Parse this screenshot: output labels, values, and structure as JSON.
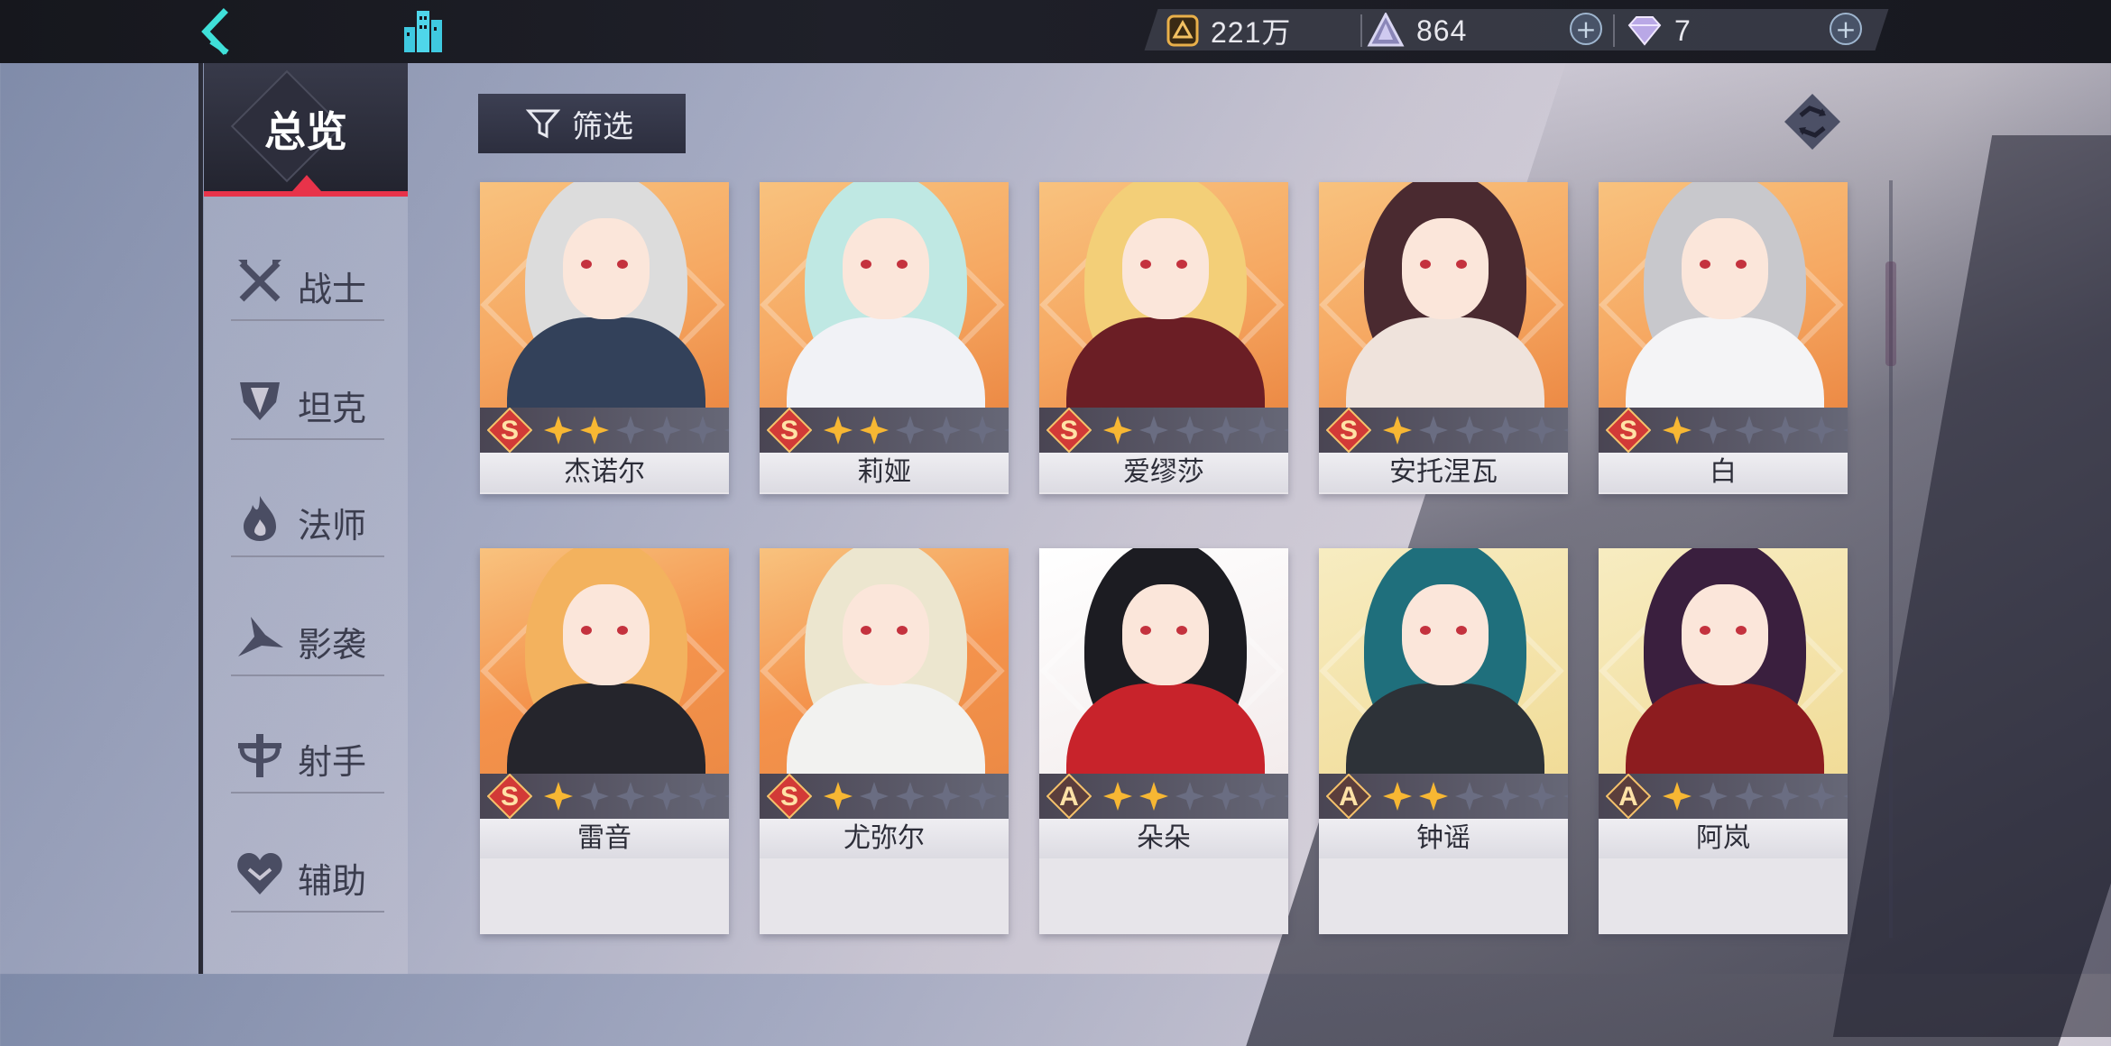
{
  "topbar": {
    "back_icon": "back-arrow-icon",
    "city_icon": "city-icon",
    "resources": [
      {
        "icon": "gold-coin-icon",
        "value": "221万"
      },
      {
        "icon": "crystal-icon",
        "value": "864"
      },
      {
        "icon": "diamond-icon",
        "value": "7"
      }
    ]
  },
  "sidebar": {
    "overview_label": "总览",
    "items": [
      {
        "label": "战士",
        "icon": "sword-icon"
      },
      {
        "label": "坦克",
        "icon": "shield-icon"
      },
      {
        "label": "法师",
        "icon": "flame-icon"
      },
      {
        "label": "影袭",
        "icon": "shadow-icon"
      },
      {
        "label": "射手",
        "icon": "crossbow-icon"
      },
      {
        "label": "辅助",
        "icon": "heart-icon"
      }
    ]
  },
  "filter": {
    "label": "筛选",
    "icon": "filter-icon"
  },
  "refresh_icon": "refresh-icon",
  "characters": [
    {
      "name": "杰诺尔",
      "rank": "S",
      "stars": 2,
      "max_stars": 6,
      "hair": "#dcdcdc",
      "outfit": "#33415a",
      "bg": "#f6a862"
    },
    {
      "name": "莉娅",
      "rank": "S",
      "stars": 2,
      "max_stars": 6,
      "hair": "#bfe8e3",
      "outfit": "#f1f2f6",
      "bg": "#f6a862"
    },
    {
      "name": "爱缪莎",
      "rank": "S",
      "stars": 1,
      "max_stars": 6,
      "hair": "#f3cf78",
      "outfit": "#6b1e25",
      "bg": "#f6a862"
    },
    {
      "name": "安托涅瓦",
      "rank": "S",
      "stars": 1,
      "max_stars": 6,
      "hair": "#4a2a30",
      "outfit": "#efe3dc",
      "bg": "#f6a862"
    },
    {
      "name": "白",
      "rank": "S",
      "stars": 1,
      "max_stars": 6,
      "hair": "#c8c8cc",
      "outfit": "#f4f4f6",
      "bg": "#f6a862"
    },
    {
      "name": "雷音",
      "rank": "S",
      "stars": 1,
      "max_stars": 6,
      "hair": "#f3b25e",
      "outfit": "#25252c",
      "bg": "#f4934c"
    },
    {
      "name": "尤弥尔",
      "rank": "S",
      "stars": 1,
      "max_stars": 6,
      "hair": "#ece6cf",
      "outfit": "#f2f2f0",
      "bg": "#f4934c"
    },
    {
      "name": "朵朵",
      "rank": "A",
      "stars": 2,
      "max_stars": 6,
      "hair": "#1c1c22",
      "outfit": "#c8232b",
      "bg": "#fbfbfb"
    },
    {
      "name": "钟谣",
      "rank": "A",
      "stars": 2,
      "max_stars": 6,
      "hair": "#1f6f7c",
      "outfit": "#2d3238",
      "bg": "#f4e3a8"
    },
    {
      "name": "阿岚",
      "rank": "A",
      "stars": 1,
      "max_stars": 6,
      "hair": "#3a1f3e",
      "outfit": "#8d1c1f",
      "bg": "#f4e3a8"
    }
  ],
  "colors": {
    "accent": "#e8334a",
    "cyan": "#3fe0d9",
    "star_gold": "#f7b733",
    "rank_red": "#d23a37"
  }
}
